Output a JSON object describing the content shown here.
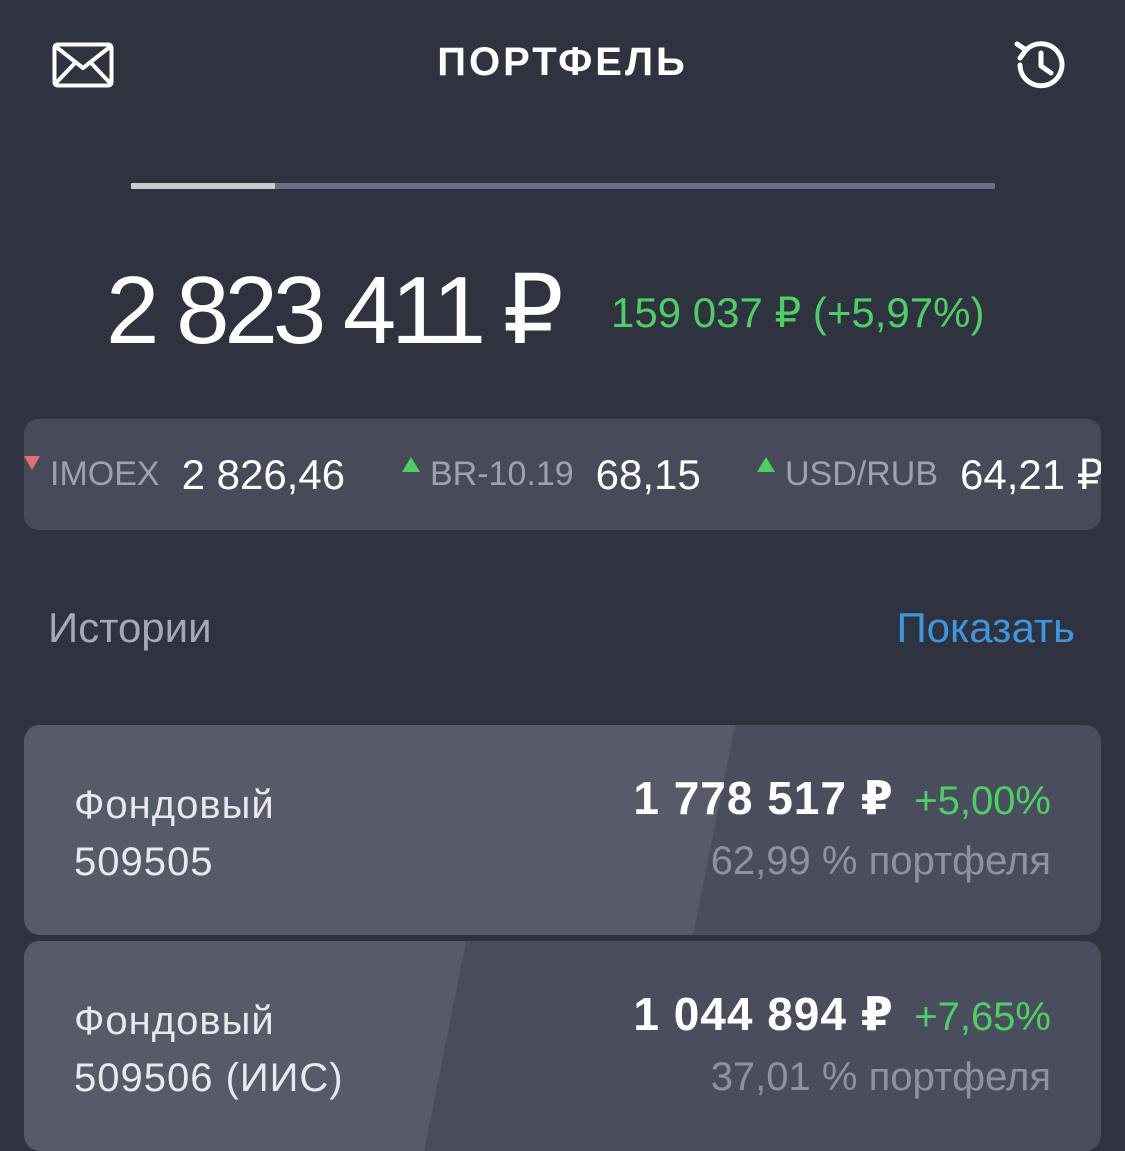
{
  "header": {
    "title": "ПОРТФЕЛЬ",
    "left_icon": "mail-icon",
    "right_icon": "history-icon"
  },
  "pager": {
    "pages": 6,
    "active_index": 0
  },
  "total": {
    "value": "2 823 411 ₽",
    "change": "159 037 ₽ (+5,97%)"
  },
  "tickers": [
    {
      "name": "IMOEX",
      "value": "2 826,46",
      "direction": "down"
    },
    {
      "name": "BR-10.19",
      "value": "68,15",
      "direction": "up"
    },
    {
      "name": "USD/RUB",
      "value": "64,21 ₽",
      "direction": "up"
    }
  ],
  "stories": {
    "label": "Истории",
    "action": "Показать"
  },
  "accounts": [
    {
      "name_line1": "Фондовый",
      "name_line2": "509505",
      "value": "1 778 517 ₽",
      "change": "+5,00%",
      "share": "62,99 % портфеля"
    },
    {
      "name_line1": "Фондовый",
      "name_line2": "509506 (ИИС)",
      "value": "1 044 894 ₽",
      "change": "+7,65%",
      "share": "37,01 % портфеля"
    }
  ],
  "colors": {
    "background": "#2f323f",
    "positive": "#4cd063",
    "negative": "#e36d73",
    "link": "#3e97de"
  }
}
